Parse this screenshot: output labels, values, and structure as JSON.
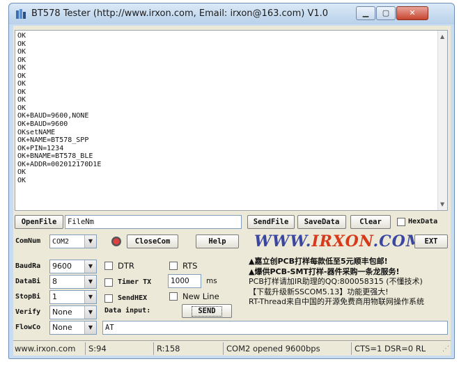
{
  "window": {
    "title": "BT578 Tester (http://www.irxon.com, Email: irxon@163.com) V1.0",
    "min_icon": "minimize-icon",
    "max_icon": "maximize-icon",
    "close_icon": "close-icon"
  },
  "output": {
    "lines": [
      "OK",
      "OK",
      "OK",
      "OK",
      "OK",
      "OK",
      "OK",
      "OK",
      "OK",
      "OK",
      "OK+BAUD=9600,NONE",
      "OK+BAUD=9600",
      "OKsetNAME",
      "OK+NAME=BT578_SPP",
      "OK+PIN=1234",
      "OK+BNAME=BT578_BLE",
      "OK+ADDR=002012170D1E",
      "OK",
      "OK"
    ]
  },
  "file_row": {
    "open_label": "OpenFile",
    "filename_value": "FileNm",
    "sendfile_label": "SendFile",
    "savedata_label": "SaveData",
    "clear_label": "Clear",
    "hexdata_label": "HexData"
  },
  "com_row": {
    "comnum_label": "ComNum",
    "comnum_value": "COM2",
    "closecom_label": "CloseCom",
    "help_label": "Help",
    "logo_part1": "WWW.",
    "logo_part2": "IRXON",
    "logo_part3": ".COM",
    "ext_label": "EXT"
  },
  "settings": {
    "baud_label": "BaudRa",
    "baud_value": "9600",
    "databits_label": "DataBi",
    "databits_value": "8",
    "stopbits_label": "StopBi",
    "stopbits_value": "1",
    "verify_label": "Verify",
    "verify_value": "None",
    "flow_label": "FlowCo",
    "flow_value": "None"
  },
  "controls": {
    "dtr_label": "DTR",
    "rts_label": "RTS",
    "timer_label": "Timer TX",
    "timer_value": "1000",
    "timer_unit": "ms",
    "sendhex_label": "SendHEX",
    "newline_label": "New Line",
    "datainput_label": "Data input:",
    "send_label": "SEND",
    "input_value": "AT"
  },
  "ad_lines": [
    "▲嘉立创PCB打样每款低至5元顺丰包邮!",
    "▲爆供PCB-SMT打样-器件采购一条龙服务!",
    "PCB打样请加IR助理的QQ:800058315 (不懂技术)",
    "【下载升级新SSCOM5.13】功能更强大!",
    "RT-Thread来自中国的开源免费商用物联网操作系统"
  ],
  "status": {
    "site": "www.irxon.com",
    "sent": "S:94",
    "received": "R:158",
    "port_status": "COM2 opened 9600bps",
    "signals": "CTS=1 DSR=0 RL"
  }
}
